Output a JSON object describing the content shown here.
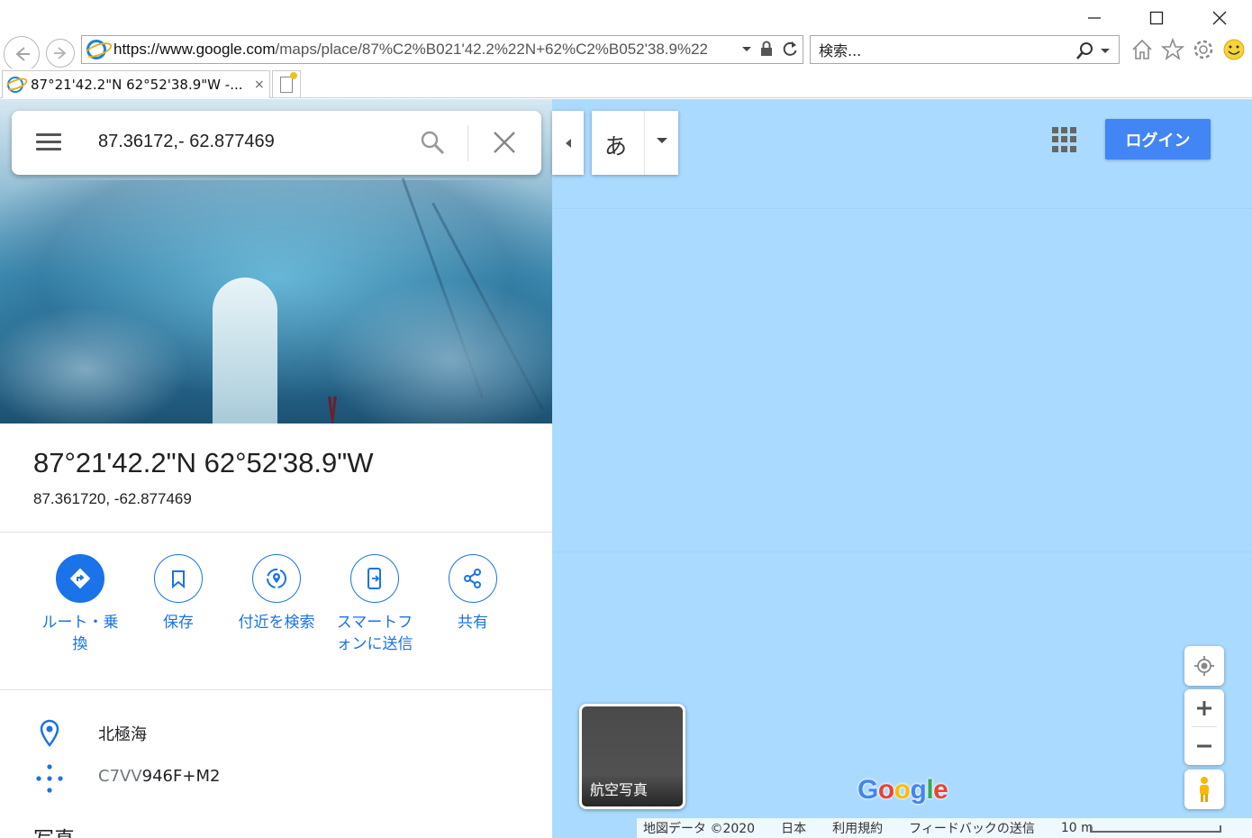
{
  "browser": {
    "url_prefix": "https://www.google.com",
    "url_rest": "/maps/place/87%C2%B021'42.2%22N+62%C2%B052'38.9%22",
    "search_placeholder": "検索...",
    "tab_title": "87°21'42.2\"N 62°52'38.9\"W -...",
    "tab_close": "×",
    "icons": [
      "back-icon",
      "forward-icon",
      "ie-logo-icon",
      "dropdown-icon",
      "lock-icon",
      "refresh-icon",
      "search-icon",
      "home-icon",
      "star-icon",
      "gear-icon",
      "smiley-icon",
      "minimize-icon",
      "maximize-icon",
      "close-icon",
      "new-tab-icon"
    ]
  },
  "searchbox": {
    "query": "87.36172,- 62.877469"
  },
  "place": {
    "title": "87°21'42.2\"N 62°52'38.9\"W",
    "coords": "87.361720, -62.877469"
  },
  "actions": [
    {
      "label": "ルート・乗換",
      "icon": "directions-icon"
    },
    {
      "label": "保存",
      "icon": "bookmark-icon"
    },
    {
      "label": "付近を検索",
      "icon": "nearby-icon"
    },
    {
      "label": "スマートフォンに送信",
      "icon": "send-to-phone-icon"
    },
    {
      "label": "共有",
      "icon": "share-icon"
    }
  ],
  "info": {
    "location": "北極海",
    "pluscode_grey": "C7VV",
    "pluscode_dark": "946F+M2"
  },
  "photos_heading": "写真",
  "map": {
    "lang_char": "あ",
    "login_label": "ログイン",
    "aerial_label": "航空写真",
    "attribution": [
      "地図データ ©2020",
      "日本",
      "利用規約",
      "フィードバックの送信",
      "10 m"
    ],
    "colors": {
      "water": "#aadaff",
      "accent": "#1a73e8",
      "login": "#4285f4"
    },
    "google_logo": [
      {
        "ch": "G",
        "color": "#4285f4"
      },
      {
        "ch": "o",
        "color": "#ea4335"
      },
      {
        "ch": "o",
        "color": "#fbbc05"
      },
      {
        "ch": "g",
        "color": "#4285f4"
      },
      {
        "ch": "l",
        "color": "#34a853"
      },
      {
        "ch": "e",
        "color": "#ea4335"
      }
    ]
  }
}
